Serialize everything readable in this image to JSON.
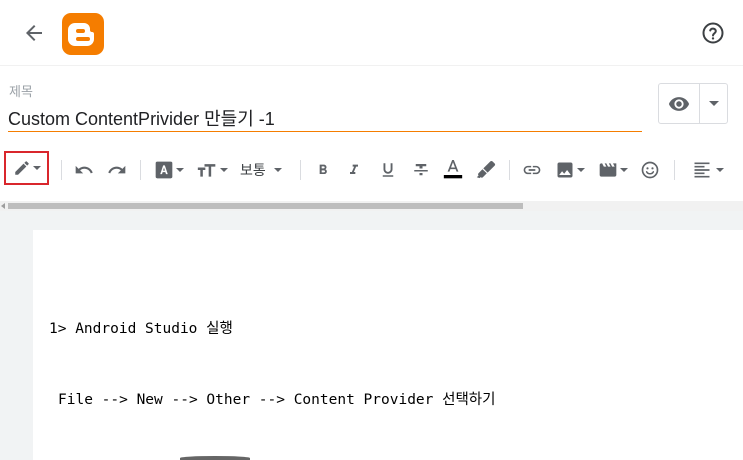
{
  "header": {
    "back_icon": "arrow-left-icon",
    "logo_icon": "blogger-logo-icon",
    "help_icon": "help-circle-icon"
  },
  "post": {
    "title_label": "제목",
    "title_value": "Custom ContentPrivider 만들기 -1"
  },
  "preview": {
    "icon": "eye-icon",
    "caret_icon": "caret-down-icon"
  },
  "toolbar": {
    "font_size_label": "보통",
    "items": [
      "pencil-icon",
      "undo-icon",
      "redo-icon",
      "font-icon",
      "text-size-icon",
      "bold-icon",
      "italic-icon",
      "underline-icon",
      "strikethrough-icon",
      "text-color-icon",
      "highlight-icon",
      "link-icon",
      "image-icon",
      "video-icon",
      "emoji-icon",
      "align-left-icon"
    ],
    "text_color": "#000000",
    "accent": "#f57d00",
    "mode_highlight": "#d9262c"
  },
  "content": {
    "line1": "1> Android Studio 실행",
    "line2": "File --> New --> Other --> Content Provider 선택하기"
  }
}
